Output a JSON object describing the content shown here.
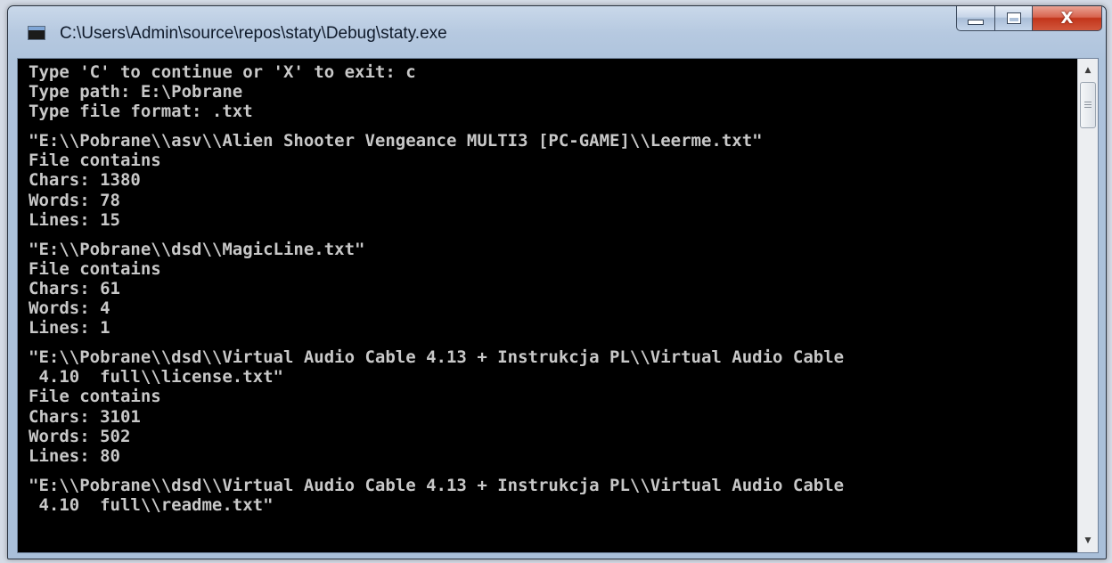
{
  "window": {
    "title": "C:\\Users\\Admin\\source\\repos\\staty\\Debug\\staty.exe",
    "close_label": "X"
  },
  "console": {
    "lines": [
      "Type 'C' to continue or 'X' to exit: c",
      "Type path: E:\\Pobrane",
      "Type file format: .txt",
      "",
      "\"E:\\\\Pobrane\\\\asv\\\\Alien Shooter Vengeance MULTI3 [PC-GAME]\\\\Leerme.txt\"",
      "File contains",
      "Chars: 1380",
      "Words: 78",
      "Lines: 15",
      "",
      "\"E:\\\\Pobrane\\\\dsd\\\\MagicLine.txt\"",
      "File contains",
      "Chars: 61",
      "Words: 4",
      "Lines: 1",
      "",
      "\"E:\\\\Pobrane\\\\dsd\\\\Virtual Audio Cable 4.13 + Instrukcja PL\\\\Virtual Audio Cable",
      " 4.10  full\\\\license.txt\"",
      "File contains",
      "Chars: 3101",
      "Words: 502",
      "Lines: 80",
      "",
      "\"E:\\\\Pobrane\\\\dsd\\\\Virtual Audio Cable 4.13 + Instrukcja PL\\\\Virtual Audio Cable",
      " 4.10  full\\\\readme.txt\""
    ]
  },
  "icons": {
    "app": "console-app-icon",
    "minimize": "minimize-icon",
    "maximize": "maximize-icon",
    "close": "close-icon",
    "scroll_up": "scroll-up-arrow-icon",
    "scroll_down": "scroll-down-arrow-icon"
  },
  "colors": {
    "console_bg": "#000000",
    "console_text": "#c8c8c8",
    "close_button": "#c7402a"
  }
}
